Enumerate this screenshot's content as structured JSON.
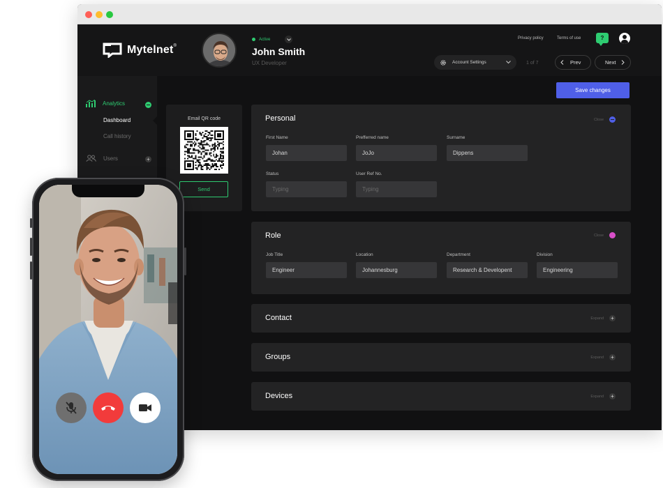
{
  "header": {
    "brand": "Mytelnet",
    "brand_mark": "®",
    "status": "Active",
    "user_name": "John Smith",
    "user_role": "UX Developer",
    "links": [
      "Privacy policy",
      "Terms of use"
    ],
    "chat_badge": "?",
    "account_settings": "Account Settings",
    "page_count": "1 of 7",
    "prev": "Prev",
    "next": "Next"
  },
  "sidebar": {
    "analytics": "Analytics",
    "dashboard": "Dashboard",
    "call_history": "Call history",
    "users": "Users"
  },
  "main": {
    "save_label": "Save changes",
    "qr_title": "Email QR code",
    "send_label": "Send",
    "personal": {
      "title": "Personal",
      "toggle": "Close",
      "first_name_label": "First Name",
      "first_name": "Johan",
      "preferred_label": "Prefferred name",
      "preferred": "JoJo",
      "surname_label": "Surname",
      "surname": "Dippens",
      "status_label": "Status",
      "status_placeholder": "Typing",
      "userref_label": "User Ref No.",
      "userref_placeholder": "Typing"
    },
    "role": {
      "title": "Role",
      "toggle": "Close",
      "job_title_label": "Job Title",
      "job_title": "Engineer",
      "location_label": "Location",
      "location": "Johannesburg",
      "department_label": "Department",
      "department": "Research & Developent",
      "division_label": "Division",
      "division": "Engineering"
    },
    "collapsed": [
      {
        "title": "Contact",
        "toggle": "Expand"
      },
      {
        "title": "Groups",
        "toggle": "Expand"
      },
      {
        "title": "Devices",
        "toggle": "Expand"
      }
    ]
  },
  "colors": {
    "accent_green": "#2ecc71",
    "accent_blue": "#4f5fe8",
    "accent_pink": "#d94fc9",
    "hangup_red": "#f23b3b"
  },
  "icons": [
    "analytics-icon",
    "users-icon",
    "gear-icon",
    "chevron-down-icon",
    "chevron-left-icon",
    "chevron-right-icon",
    "chat-icon",
    "profile-icon",
    "qr-code-icon",
    "mute-mic-icon",
    "hang-up-icon",
    "video-camera-icon"
  ]
}
